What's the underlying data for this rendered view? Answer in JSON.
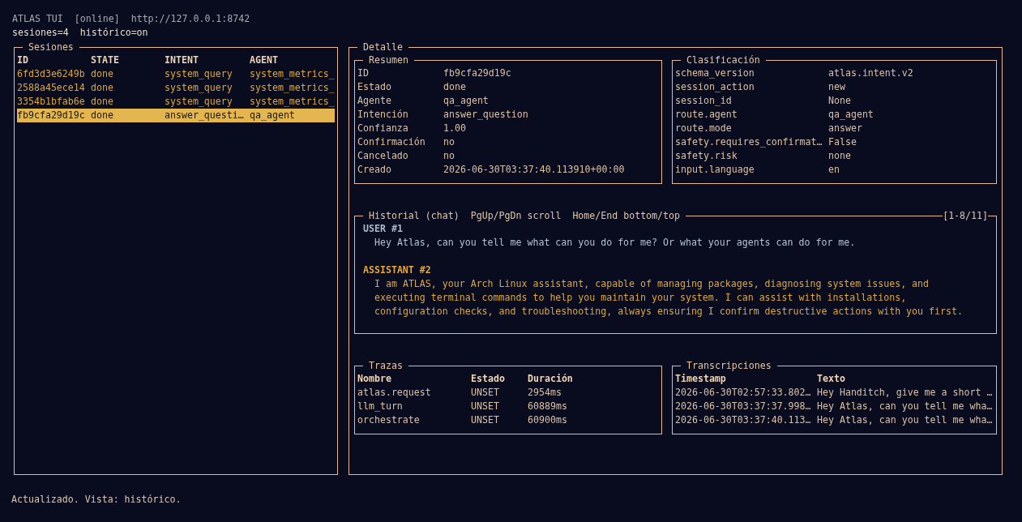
{
  "header": {
    "title": "ATLAS TUI",
    "status": "[online]",
    "url": "http://127.0.0.1:8742",
    "flags": [
      "sesiones=4",
      "histórico=on"
    ]
  },
  "sessions": {
    "title": "Sesiones",
    "columns": [
      "ID",
      "STATE",
      "INTENT",
      "AGENT"
    ],
    "rows": [
      {
        "cells": [
          "6fd3d3e6249b",
          "done",
          "system_query",
          "system_metrics_"
        ],
        "selected": false
      },
      {
        "cells": [
          "2588a45ece14",
          "done",
          "system_query",
          "system_metrics_"
        ],
        "selected": false
      },
      {
        "cells": [
          "3354b1bfab6e",
          "done",
          "system_query",
          "system_metrics_"
        ],
        "selected": false
      },
      {
        "cells": [
          "fb9cfa29d19c",
          "done",
          "answer_questi…",
          "qa_agent"
        ],
        "selected": true
      }
    ]
  },
  "detail": {
    "title": "Detalle",
    "summary": {
      "title": "Resumen",
      "fields": [
        {
          "label": "ID",
          "value": "fb9cfa29d19c"
        },
        {
          "label": "Estado",
          "value": "done"
        },
        {
          "label": "Agente",
          "value": "qa_agent"
        },
        {
          "label": "Intención",
          "value": "answer_question"
        },
        {
          "label": "Confianza",
          "value": "1.00"
        },
        {
          "label": "Confirmación",
          "value": "no"
        },
        {
          "label": "Cancelado",
          "value": "no"
        },
        {
          "label": "Creado",
          "value": "2026-06-30T03:37:40.113910+00:00"
        }
      ]
    },
    "classification": {
      "title": "Clasificación",
      "fields": [
        {
          "label": "schema_version",
          "value": "atlas.intent.v2"
        },
        {
          "label": "session_action",
          "value": "new"
        },
        {
          "label": "session_id",
          "value": "None"
        },
        {
          "label": "route.agent",
          "value": "qa_agent"
        },
        {
          "label": "route.mode",
          "value": "answer"
        },
        {
          "label": "safety.requires_confirmat…",
          "value": "False"
        },
        {
          "label": "safety.risk",
          "value": "none"
        },
        {
          "label": "input.language",
          "value": "en"
        }
      ]
    },
    "history": {
      "title": "Historial (chat)",
      "hints": [
        "PgUp/PgDn scroll",
        "Home/End bottom/top"
      ],
      "range": "[1-8/11]",
      "messages": [
        {
          "kind": "user",
          "author": "USER #1",
          "text": "Hey Atlas, can you tell me what can you do for me? Or what your agents can do for me."
        },
        {
          "kind": "assistant",
          "author": "ASSISTANT #2",
          "text": "I am ATLAS, your Arch Linux assistant, capable of managing packages, diagnosing system issues, and executing terminal commands to help you maintain your system. I can assist with installations, configuration checks, and troubleshooting, always ensuring I confirm destructive actions with you first."
        }
      ]
    },
    "traces": {
      "title": "Trazas",
      "columns": [
        "Nombre",
        "Estado",
        "Duración"
      ],
      "rows": [
        [
          "atlas.request",
          "UNSET",
          "2954ms"
        ],
        [
          "llm_turn",
          "UNSET",
          "60889ms"
        ],
        [
          "orchestrate",
          "UNSET",
          "60900ms"
        ]
      ]
    },
    "transcriptions": {
      "title": "Transcripciones",
      "columns": [
        "Timestamp",
        "Texto"
      ],
      "rows": [
        [
          "2026-06-30T02:57:33.802…",
          "Hey Handitch, give me a short …"
        ],
        [
          "2026-06-30T03:37:37.998…",
          "Hey Atlas, can you tell me wha…"
        ],
        [
          "2026-06-30T03:37:40.113…",
          "Hey Atlas, can you tell me wha…"
        ]
      ]
    }
  },
  "status_bar": "Actualizado. Vista: histórico."
}
